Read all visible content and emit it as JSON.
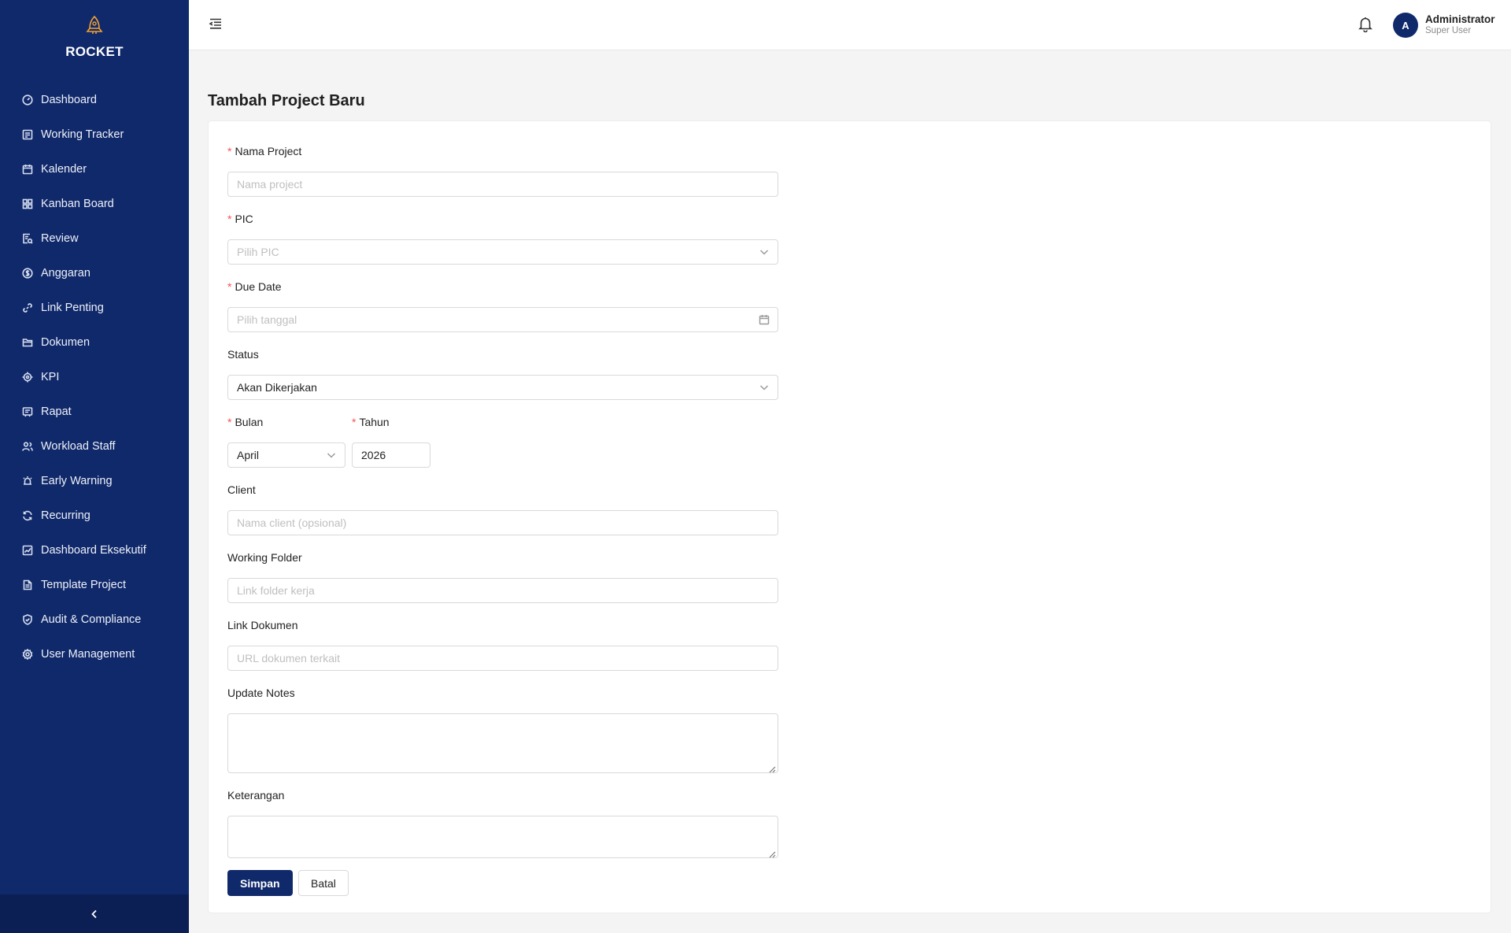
{
  "app": {
    "name": "ROCKET"
  },
  "sidebar": {
    "items": [
      {
        "label": "Dashboard",
        "icon": "dashboard-icon"
      },
      {
        "label": "Working Tracker",
        "icon": "tracker-icon"
      },
      {
        "label": "Kalender",
        "icon": "calendar-icon"
      },
      {
        "label": "Kanban Board",
        "icon": "kanban-icon"
      },
      {
        "label": "Review",
        "icon": "review-icon"
      },
      {
        "label": "Anggaran",
        "icon": "budget-icon"
      },
      {
        "label": "Link Penting",
        "icon": "link-icon"
      },
      {
        "label": "Dokumen",
        "icon": "folder-icon"
      },
      {
        "label": "KPI",
        "icon": "target-icon"
      },
      {
        "label": "Rapat",
        "icon": "meeting-icon"
      },
      {
        "label": "Workload Staff",
        "icon": "team-icon"
      },
      {
        "label": "Early Warning",
        "icon": "alarm-icon"
      },
      {
        "label": "Recurring",
        "icon": "sync-icon"
      },
      {
        "label": "Dashboard Eksekutif",
        "icon": "chart-icon"
      },
      {
        "label": "Template Project",
        "icon": "file-icon"
      },
      {
        "label": "Audit & Compliance",
        "icon": "shield-check-icon"
      },
      {
        "label": "User Management",
        "icon": "gear-icon"
      }
    ]
  },
  "header": {
    "user_name": "Administrator",
    "user_role": "Super User",
    "avatar_letter": "A"
  },
  "page": {
    "title": "Tambah Project Baru"
  },
  "form": {
    "nama_project": {
      "label": "Nama Project",
      "placeholder": "Nama project",
      "required": true
    },
    "pic": {
      "label": "PIC",
      "placeholder": "Pilih PIC",
      "required": true
    },
    "due_date": {
      "label": "Due Date",
      "placeholder": "Pilih tanggal",
      "required": true
    },
    "status": {
      "label": "Status",
      "value": "Akan Dikerjakan"
    },
    "bulan": {
      "label": "Bulan",
      "value": "April",
      "required": true
    },
    "tahun": {
      "label": "Tahun",
      "value": "2026",
      "required": true
    },
    "client": {
      "label": "Client",
      "placeholder": "Nama client (opsional)"
    },
    "working_folder": {
      "label": "Working Folder",
      "placeholder": "Link folder kerja"
    },
    "link_dokumen": {
      "label": "Link Dokumen",
      "placeholder": "URL dokumen terkait"
    },
    "update_notes": {
      "label": "Update Notes",
      "value": ""
    },
    "keterangan": {
      "label": "Keterangan",
      "value": ""
    },
    "required_mark": "*"
  },
  "actions": {
    "save": "Simpan",
    "cancel": "Batal"
  },
  "colors": {
    "sidebar": "#10296b",
    "sidebar_footer": "#0b1f55",
    "primary": "#10296b",
    "required": "#ff4d4f",
    "brand_icon": "#f0a030"
  }
}
